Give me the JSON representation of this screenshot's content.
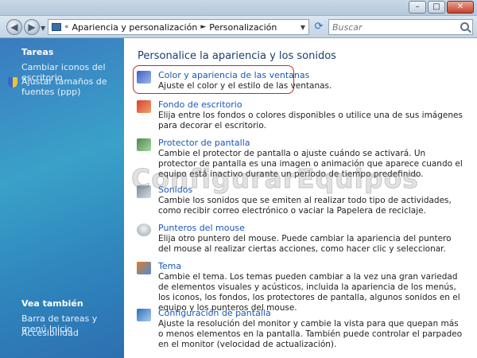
{
  "window": {
    "minimize_glyph": "–",
    "maximize_glyph": "□",
    "close_glyph": "✕"
  },
  "address": {
    "back_glyph": "◀",
    "forward_glyph": "▶",
    "prefix": "«",
    "crumbs": [
      "Apariencia y personalización",
      "Personalización"
    ],
    "separator": "►",
    "search_placeholder": "Buscar"
  },
  "sidebar": {
    "tasks_heading": "Tareas",
    "tasks": [
      "Cambiar iconos del escritorio",
      "Ajustar tamaños de fuentes (ppp)"
    ],
    "see_also_heading": "Vea también",
    "see_also": [
      "Barra de tareas y menú Inicio",
      "Accesibilidad"
    ]
  },
  "main": {
    "title": "Personalice la apariencia y los sonidos",
    "categories": [
      {
        "label": "Color y apariencia de las ventanas",
        "desc": "Ajuste el color y el estilo de las ventanas.",
        "icon": "window-color-icon",
        "color": "#3b5fc6"
      },
      {
        "label": "Fondo de escritorio",
        "desc": "Elija entre los fondos o colores disponibles o utilice una de sus imágenes para decorar el escritorio.",
        "icon": "desktop-background-icon",
        "color": "#d8402e"
      },
      {
        "label": "Protector de pantalla",
        "desc": "Cambie el protector de pantalla o ajuste cuándo se activará. Un protector de pantalla es una imagen o animación que aparece cuando el equipo está inactivo durante un periodo de tiempo predefinido.",
        "icon": "screensaver-icon",
        "color": "#4a8a4e"
      },
      {
        "label": "Sonidos",
        "desc": "Cambie los sonidos que se emiten al realizar todo tipo de actividades, como recibir correo electrónico o vaciar la Papelera de reciclaje.",
        "icon": "sounds-icon",
        "color": "#7b8a99"
      },
      {
        "label": "Punteros del mouse",
        "desc": "Elija otro puntero del mouse. Puede cambiar la apariencia del puntero del mouse al realizar ciertas acciones, como hacer clic y seleccionar.",
        "icon": "mouse-pointer-icon",
        "color": "#9ba3ab"
      },
      {
        "label": "Tema",
        "desc": "Cambie el tema. Los temas pueden cambiar a la vez una gran variedad de elementos visuales y acústicos, incluida la apariencia de los menús, los iconos, los fondos, los protectores de pantalla, algunos sonidos en el equipo y los punteros del mouse.",
        "icon": "theme-icon",
        "color": "#e07a2a"
      },
      {
        "label": "Configuración de pantalla",
        "desc": "Ajuste la resolución del monitor y cambie la vista para que quepan más o menos elementos en la pantalla. También puede controlar el parpadeo en el monitor (velocidad de actualización).",
        "icon": "display-settings-icon",
        "color": "#2f6fb8"
      }
    ]
  },
  "watermark": "ConfigurarEquipos"
}
